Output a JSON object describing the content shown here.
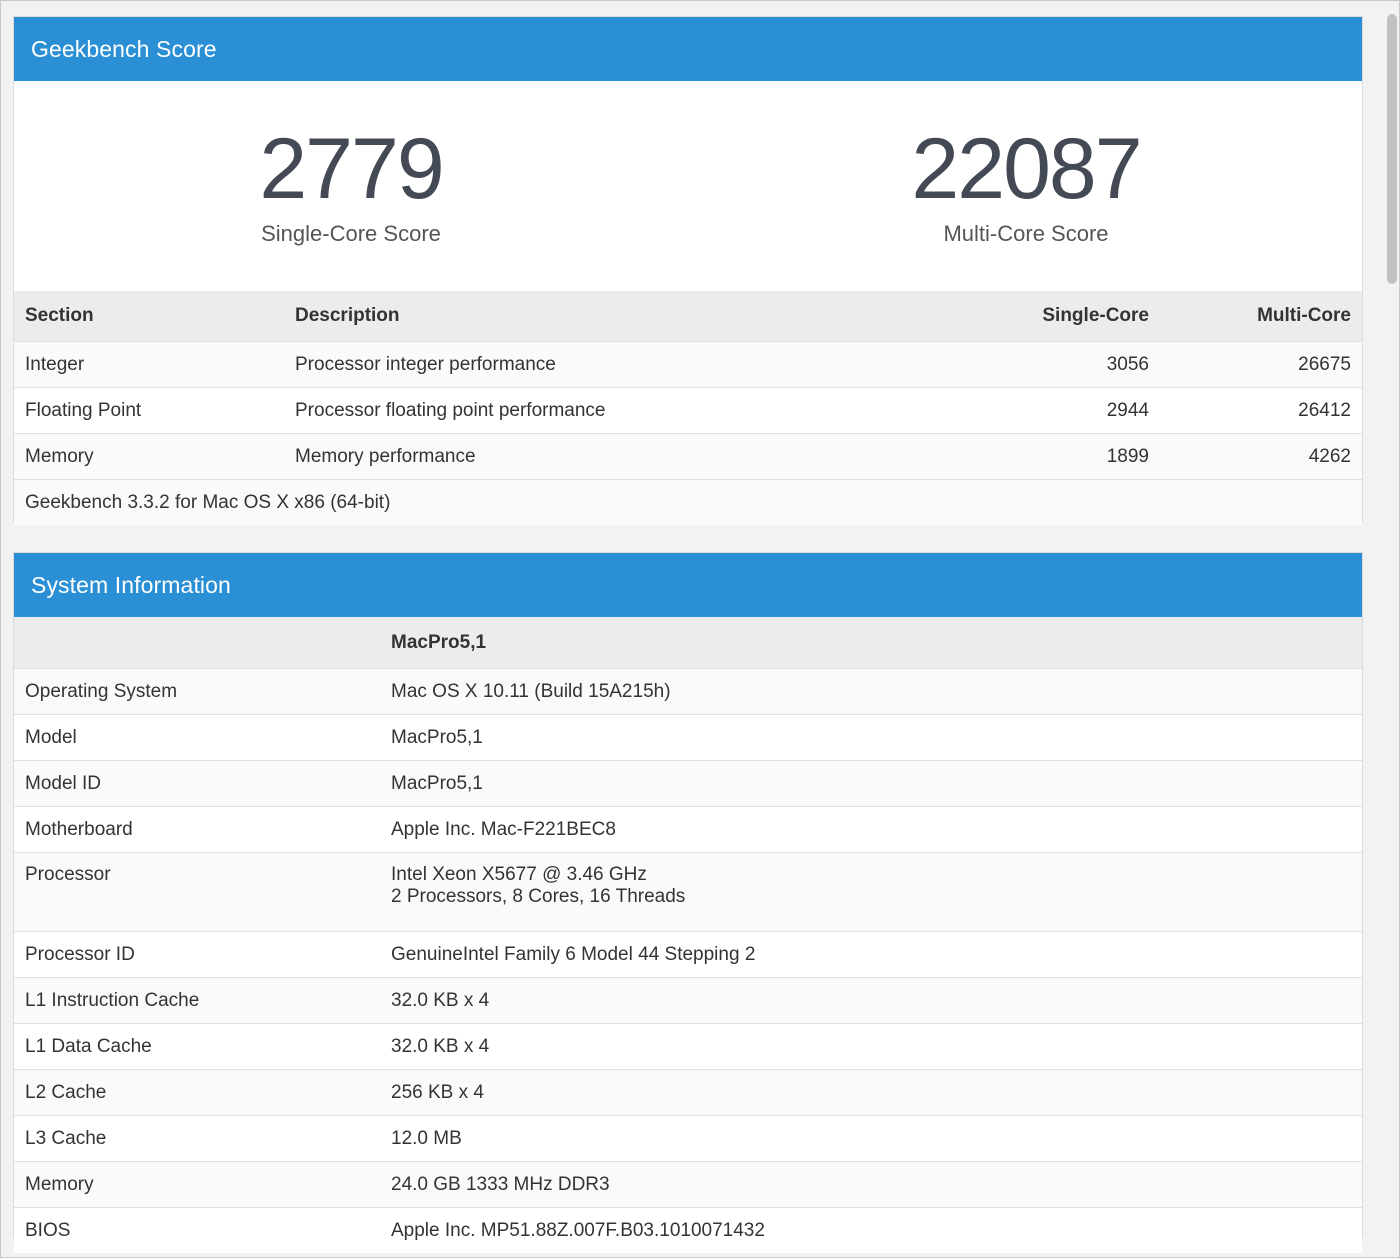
{
  "score_card": {
    "title": "Geekbench Score",
    "single": {
      "value": "2779",
      "label": "Single-Core Score"
    },
    "multi": {
      "value": "22087",
      "label": "Multi-Core Score"
    },
    "headers": {
      "section": "Section",
      "description": "Description",
      "single": "Single-Core",
      "multi": "Multi-Core"
    },
    "rows": [
      {
        "section": "Integer",
        "description": "Processor integer performance",
        "single": "3056",
        "multi": "26675"
      },
      {
        "section": "Floating Point",
        "description": "Processor floating point performance",
        "single": "2944",
        "multi": "26412"
      },
      {
        "section": "Memory",
        "description": "Memory performance",
        "single": "1899",
        "multi": "4262"
      }
    ],
    "footnote": "Geekbench 3.3.2 for Mac OS X x86 (64-bit)"
  },
  "system_card": {
    "title": "System Information",
    "header_value": "MacPro5,1",
    "rows": [
      {
        "key": "Operating System",
        "value": "Mac OS X 10.11 (Build 15A215h)"
      },
      {
        "key": "Model",
        "value": "MacPro5,1"
      },
      {
        "key": "Model ID",
        "value": "MacPro5,1"
      },
      {
        "key": "Motherboard",
        "value": "Apple Inc. Mac-F221BEC8"
      },
      {
        "key": "Processor",
        "value": "Intel Xeon X5677 @ 3.46 GHz",
        "value2": "2 Processors, 8 Cores, 16 Threads"
      },
      {
        "key": "Processor ID",
        "value": "GenuineIntel Family 6 Model 44 Stepping 2"
      },
      {
        "key": "L1 Instruction Cache",
        "value": "32.0 KB x 4"
      },
      {
        "key": "L1 Data Cache",
        "value": "32.0 KB x 4"
      },
      {
        "key": "L2 Cache",
        "value": "256 KB x 4"
      },
      {
        "key": "L3 Cache",
        "value": "12.0 MB"
      },
      {
        "key": "Memory",
        "value": "24.0 GB 1333 MHz DDR3"
      },
      {
        "key": "BIOS",
        "value": "Apple Inc. MP51.88Z.007F.B03.1010071432"
      }
    ]
  },
  "colors": {
    "header_blue": "#2a8fd4",
    "score_text": "#444a55"
  }
}
